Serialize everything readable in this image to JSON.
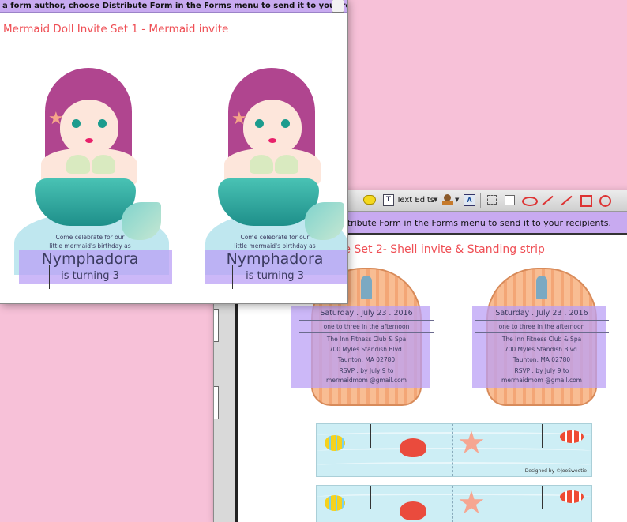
{
  "window1": {
    "form_bar_text": "a form author, choose Distribute Form in the Forms menu to send it to your recipients.",
    "doc_title": "Mermaid Doll Invite Set 1 - Mermaid invite",
    "card_text_1": "Come celebrate for our",
    "card_text_2": "little mermaid's birthday as",
    "name": "Nymphadora",
    "turning": "is turning 3"
  },
  "window2": {
    "toolbar": {
      "text_edits_label": "Text Edits"
    },
    "form_bar_text": "istribute Form in the Forms menu to send it to your recipients.",
    "doc_title": "ite Set 2- Shell invite & Standing strip",
    "invite": {
      "date": "Saturday . July 23 . 2016",
      "time": "one to three in the afternoon",
      "venue": "The Inn Fitness Club & Spa",
      "street": "700 Myles Standish Blvd.",
      "city": "Taunton, MA 02780",
      "rsvp": "RSVP . by July 9 to",
      "email": "mermaidmom @gmail.com"
    },
    "credit": "Designed by ©JooSweetie"
  },
  "colors": {
    "background": "#f7c1d8",
    "form_bar": "#c8aaf0",
    "title_red": "#ef4f55",
    "band_purple": "#bba0f5",
    "hair": "#b0458f",
    "tail": "#2faea4",
    "shell": "#f6b07f",
    "strip_sky": "#cdeef5"
  }
}
